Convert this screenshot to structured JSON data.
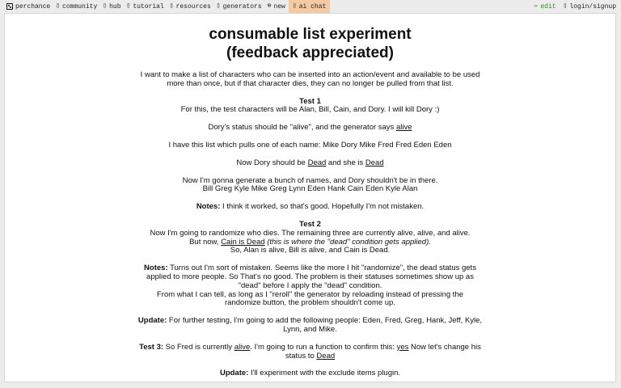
{
  "nav": {
    "left": [
      {
        "id": "perchance",
        "icon": "die-icon",
        "label": "perchance"
      },
      {
        "id": "community",
        "icon": "▯",
        "label": "community"
      },
      {
        "id": "hub",
        "icon": "▯",
        "label": "hub"
      },
      {
        "id": "tutorial",
        "icon": "▯",
        "label": "tutorial"
      },
      {
        "id": "resources",
        "icon": "▯",
        "label": "resources"
      },
      {
        "id": "generators",
        "icon": "▯",
        "label": "generators"
      },
      {
        "id": "new",
        "icon": "⊕",
        "label": "new"
      },
      {
        "id": "ai-chat",
        "icon": "▯",
        "label": "ai chat"
      }
    ],
    "right": [
      {
        "id": "edit",
        "icon": "✏",
        "label": "edit"
      },
      {
        "id": "login",
        "icon": "▯",
        "label": "login/signup"
      }
    ],
    "active_color": "#f5c9a2",
    "edit_color": "#3a8a2a"
  },
  "page": {
    "title_line1": "consumable list experiment",
    "title_line2": "(feedback appreciated)",
    "intro": "I want to make a list of characters who can be inserted into an action/event and available to be used more than once, but if that character dies, they can no longer be pulled from that list.",
    "test1_heading": "Test 1",
    "test1_text": "For this, the test characters will be Alan, Bill, Cain, and Dory. I will kill Dory :)",
    "dory_status_pre": "Dory's status should be \"alive\", and the generator says ",
    "dory_status_val": "alive",
    "list_pull": "I have this list which pulls one of each name: Mike Dory Mike Fred Fred Eden Eden",
    "now_dory_pre": "Now Dory should be ",
    "now_dory_val1": "Dead",
    "now_dory_mid": " and she is ",
    "now_dory_val2": "Dead",
    "generate_line1": "Now I'm gonna generate a bunch of names, and Dory shouldn't be in there.",
    "generate_line2": "Bill Greg Kyle Mike Greg Lynn Eden Hank Cain Eden Kyle Alan",
    "notes1_label": "Notes:",
    "notes1_text": " I think it worked, so that's good. Hopefully I'm not mistaken.",
    "test2_heading": "Test 2",
    "test2_line1": "Now I'm going to randomize who dies. The remaining three are currently alive, alive, and alive.",
    "test2_but": "But now, ",
    "test2_cain": "Cain is Dead",
    "test2_italic": " (this is where the \"dead\" condition gets applied).",
    "test2_line3": "So, Alan is alive, Bill is alive, and Cain is Dead.",
    "notes2_label": "Notes:",
    "notes2_text": " Turns out I'm sort of mistaken. Seems like the more I hit \"randomize\", the dead status gets applied to more people. So That's no good. The problem is their statuses sometimes show up as \"dead\" before I apply the \"dead\" condition.",
    "notes2_text2": "From what I can tell, as long as I \"reroll\" the generator by reloading instead of pressing the randomize button, the problem shouldn't come up.",
    "update1_label": "Update:",
    "update1_text": " For further testing, I'm going to add the following people: Eden, Fred, Greg, Hank, Jeff, Kyle, Lynn, and Mike.",
    "test3_label": "Test 3:",
    "test3_pre": " So Fred is currently ",
    "test3_alive": "alive",
    "test3_mid": ". I'm going to run a function to confirm this: ",
    "test3_yes": "yes",
    "test3_post": " Now let's change his status to ",
    "test3_dead": "Dead",
    "update2_label": "Update:",
    "update2_text": " I'll experiment with the exclude items plugin."
  }
}
